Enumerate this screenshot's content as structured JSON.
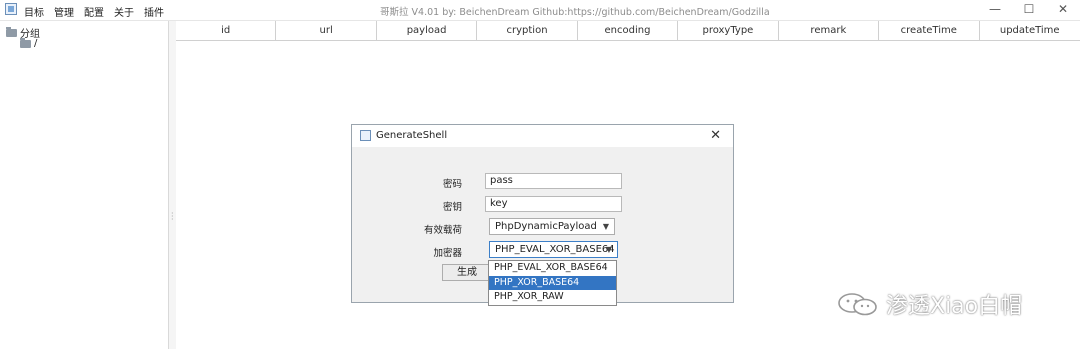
{
  "titlebar": {
    "menus": [
      "目标",
      "管理",
      "配置",
      "关于",
      "插件"
    ],
    "title": "哥斯拉   V4.01 by: BeichenDream Github:https://github.com/BeichenDream/Godzilla",
    "controls": {
      "minimize": "—",
      "maximize": "☐",
      "close": "✕"
    }
  },
  "tree": {
    "root_label": "分组",
    "child_label": "/"
  },
  "table": {
    "columns": [
      "id",
      "url",
      "payload",
      "cryption",
      "encoding",
      "proxyType",
      "remark",
      "createTime",
      "updateTime"
    ]
  },
  "dialog": {
    "title": "GenerateShell",
    "close": "✕",
    "password_label": "密码",
    "password_value": "pass",
    "key_label": "密钥",
    "key_value": "key",
    "payload_label": "有效载荷",
    "payload_value": "PhpDynamicPayload",
    "cryption_label": "加密器",
    "cryption_value": "PHP_EVAL_XOR_BASE64",
    "generate_label": "生成",
    "arrow": "▼"
  },
  "dropdown": {
    "options": [
      "PHP_EVAL_XOR_BASE64",
      "PHP_XOR_BASE64",
      "PHP_XOR_RAW"
    ],
    "selected_index": 1
  },
  "watermark": {
    "text": "渗透Xiao白帽"
  }
}
